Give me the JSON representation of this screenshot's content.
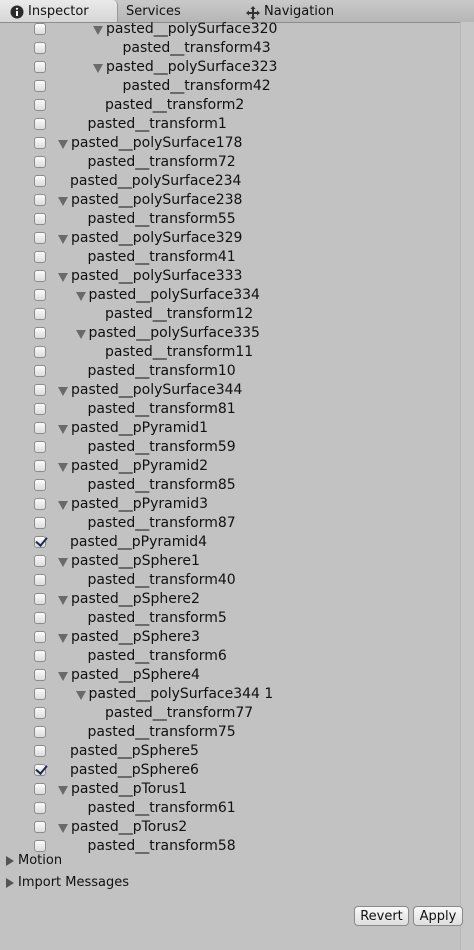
{
  "tabs": [
    {
      "label": "Inspector",
      "icon": "info-icon",
      "active": true
    },
    {
      "label": "Services",
      "icon": "",
      "active": false
    },
    {
      "label": "Navigation",
      "icon": "navigation-icon",
      "active": false
    }
  ],
  "tree": [
    {
      "label": "pasted__polySurface320",
      "depth": 2,
      "expanded": true,
      "checked": false
    },
    {
      "label": "pasted__transform43",
      "depth": 3,
      "expanded": false,
      "checked": false
    },
    {
      "label": "pasted__polySurface323",
      "depth": 2,
      "expanded": true,
      "checked": false
    },
    {
      "label": "pasted__transform42",
      "depth": 3,
      "expanded": false,
      "checked": false
    },
    {
      "label": "pasted__transform2",
      "depth": 2,
      "expanded": false,
      "checked": false
    },
    {
      "label": "pasted__transform1",
      "depth": 1,
      "expanded": false,
      "checked": false
    },
    {
      "label": "pasted__polySurface178",
      "depth": 0,
      "expanded": true,
      "checked": false
    },
    {
      "label": "pasted__transform72",
      "depth": 1,
      "expanded": false,
      "checked": false
    },
    {
      "label": "pasted__polySurface234",
      "depth": 0,
      "expanded": false,
      "checked": false
    },
    {
      "label": "pasted__polySurface238",
      "depth": 0,
      "expanded": true,
      "checked": false
    },
    {
      "label": "pasted__transform55",
      "depth": 1,
      "expanded": false,
      "checked": false
    },
    {
      "label": "pasted__polySurface329",
      "depth": 0,
      "expanded": true,
      "checked": false
    },
    {
      "label": "pasted__transform41",
      "depth": 1,
      "expanded": false,
      "checked": false
    },
    {
      "label": "pasted__polySurface333",
      "depth": 0,
      "expanded": true,
      "checked": false
    },
    {
      "label": "pasted__polySurface334",
      "depth": 1,
      "expanded": true,
      "checked": false
    },
    {
      "label": "pasted__transform12",
      "depth": 2,
      "expanded": false,
      "checked": false
    },
    {
      "label": "pasted__polySurface335",
      "depth": 1,
      "expanded": true,
      "checked": false
    },
    {
      "label": "pasted__transform11",
      "depth": 2,
      "expanded": false,
      "checked": false
    },
    {
      "label": "pasted__transform10",
      "depth": 1,
      "expanded": false,
      "checked": false
    },
    {
      "label": "pasted__polySurface344",
      "depth": 0,
      "expanded": true,
      "checked": false
    },
    {
      "label": "pasted__transform81",
      "depth": 1,
      "expanded": false,
      "checked": false
    },
    {
      "label": "pasted__pPyramid1",
      "depth": 0,
      "expanded": true,
      "checked": false
    },
    {
      "label": "pasted__transform59",
      "depth": 1,
      "expanded": false,
      "checked": false
    },
    {
      "label": "pasted__pPyramid2",
      "depth": 0,
      "expanded": true,
      "checked": false
    },
    {
      "label": "pasted__transform85",
      "depth": 1,
      "expanded": false,
      "checked": false
    },
    {
      "label": "pasted__pPyramid3",
      "depth": 0,
      "expanded": true,
      "checked": false
    },
    {
      "label": "pasted__transform87",
      "depth": 1,
      "expanded": false,
      "checked": false
    },
    {
      "label": "pasted__pPyramid4",
      "depth": 0,
      "expanded": false,
      "checked": true
    },
    {
      "label": "pasted__pSphere1",
      "depth": 0,
      "expanded": true,
      "checked": false
    },
    {
      "label": "pasted__transform40",
      "depth": 1,
      "expanded": false,
      "checked": false
    },
    {
      "label": "pasted__pSphere2",
      "depth": 0,
      "expanded": true,
      "checked": false
    },
    {
      "label": "pasted__transform5",
      "depth": 1,
      "expanded": false,
      "checked": false
    },
    {
      "label": "pasted__pSphere3",
      "depth": 0,
      "expanded": true,
      "checked": false
    },
    {
      "label": "pasted__transform6",
      "depth": 1,
      "expanded": false,
      "checked": false
    },
    {
      "label": "pasted__pSphere4",
      "depth": 0,
      "expanded": true,
      "checked": false
    },
    {
      "label": "pasted__polySurface344 1",
      "depth": 1,
      "expanded": true,
      "checked": false
    },
    {
      "label": "pasted__transform77",
      "depth": 2,
      "expanded": false,
      "checked": false
    },
    {
      "label": "pasted__transform75",
      "depth": 1,
      "expanded": false,
      "checked": false
    },
    {
      "label": "pasted__pSphere5",
      "depth": 0,
      "expanded": false,
      "checked": false
    },
    {
      "label": "pasted__pSphere6",
      "depth": 0,
      "expanded": false,
      "checked": true
    },
    {
      "label": "pasted__pTorus1",
      "depth": 0,
      "expanded": true,
      "checked": false
    },
    {
      "label": "pasted__transform61",
      "depth": 1,
      "expanded": false,
      "checked": false
    },
    {
      "label": "pasted__pTorus2",
      "depth": 0,
      "expanded": true,
      "checked": false
    },
    {
      "label": "pasted__transform58",
      "depth": 1,
      "expanded": false,
      "checked": false
    }
  ],
  "sections": [
    {
      "label": "Motion"
    },
    {
      "label": "Import Messages"
    }
  ],
  "buttons": {
    "revert": "Revert",
    "apply": "Apply"
  }
}
